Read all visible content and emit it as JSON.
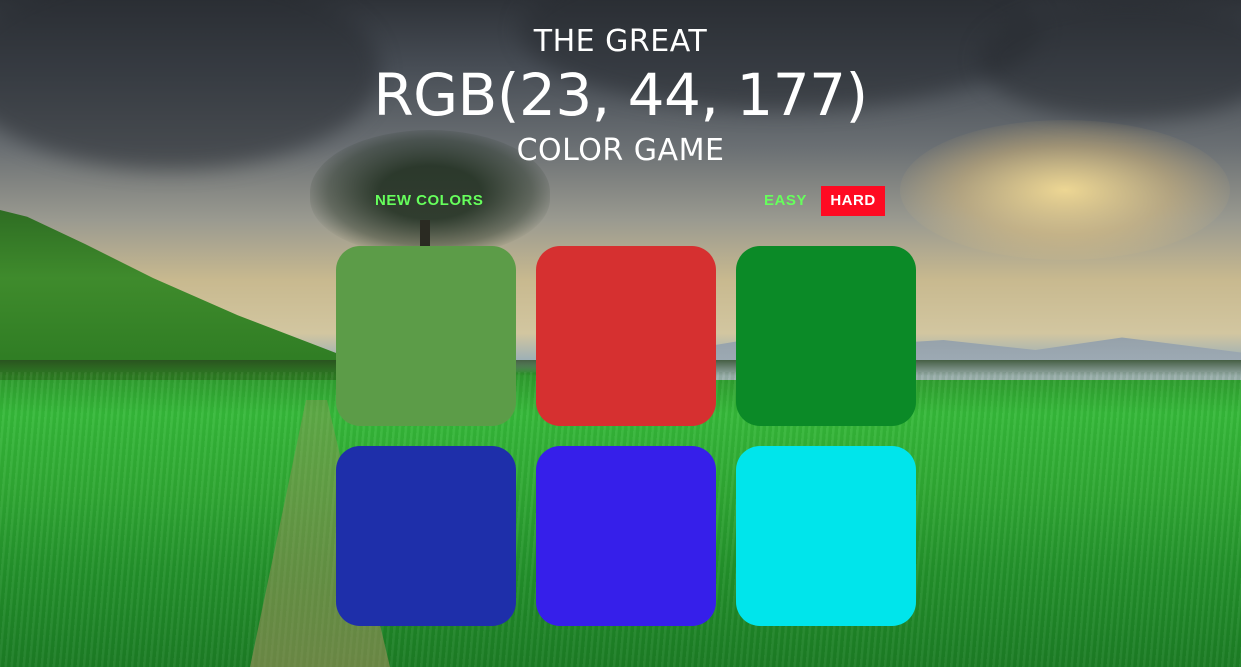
{
  "header": {
    "title_top": "THE GREAT",
    "target_rgb": "RGB(23, 44, 177)",
    "title_bottom": "COLOR GAME"
  },
  "controls": {
    "new_colors_label": "NEW COLORS",
    "easy_label": "EASY",
    "hard_label": "HARD",
    "selected_mode": "HARD"
  },
  "squares": [
    {
      "color": "#5c9c48"
    },
    {
      "color": "#d63030"
    },
    {
      "color": "#0b8a27"
    },
    {
      "color": "#1e2faa"
    },
    {
      "color": "#361fea"
    },
    {
      "color": "#00e5eb"
    }
  ],
  "colors": {
    "accent_text": "#66ff5c",
    "selected_button_bg": "#ff0a22"
  }
}
